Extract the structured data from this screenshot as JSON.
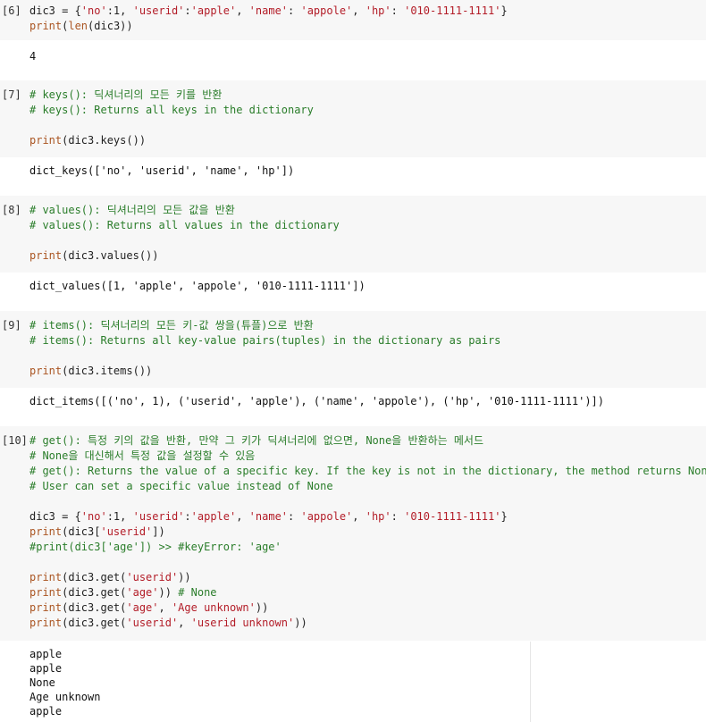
{
  "cells": [
    {
      "prompt": "[6]",
      "lines": [
        [
          {
            "t": "dic3 = {",
            "c": "n"
          },
          {
            "t": "'no'",
            "c": "s"
          },
          {
            "t": ":1, ",
            "c": "n"
          },
          {
            "t": "'userid'",
            "c": "s"
          },
          {
            "t": ":",
            "c": "n"
          },
          {
            "t": "'apple'",
            "c": "s"
          },
          {
            "t": ", ",
            "c": "n"
          },
          {
            "t": "'name'",
            "c": "s"
          },
          {
            "t": ": ",
            "c": "n"
          },
          {
            "t": "'appole'",
            "c": "s"
          },
          {
            "t": ", ",
            "c": "n"
          },
          {
            "t": "'hp'",
            "c": "s"
          },
          {
            "t": ": ",
            "c": "n"
          },
          {
            "t": "'010-1111-1111'",
            "c": "s"
          },
          {
            "t": "}",
            "c": "n"
          }
        ],
        [
          {
            "t": "print",
            "c": "f"
          },
          {
            "t": "(",
            "c": "n"
          },
          {
            "t": "len",
            "c": "f"
          },
          {
            "t": "(dic3))",
            "c": "n"
          }
        ]
      ],
      "output": [
        "4"
      ]
    },
    {
      "prompt": "[7]",
      "lines": [
        [
          {
            "t": "# keys(): 딕셔너리의 모든 키를 반환",
            "c": "k"
          }
        ],
        [
          {
            "t": "# keys(): Returns all keys in the dictionary",
            "c": "k"
          }
        ],
        [
          {
            "t": "",
            "c": "n"
          }
        ],
        [
          {
            "t": "print",
            "c": "f"
          },
          {
            "t": "(dic3.keys())",
            "c": "n"
          }
        ]
      ],
      "output": [
        "dict_keys(['no', 'userid', 'name', 'hp'])"
      ]
    },
    {
      "prompt": "[8]",
      "lines": [
        [
          {
            "t": "# values(): 딕셔너리의 모든 값을 반환",
            "c": "k"
          }
        ],
        [
          {
            "t": "# values(): Returns all values in the dictionary",
            "c": "k"
          }
        ],
        [
          {
            "t": "",
            "c": "n"
          }
        ],
        [
          {
            "t": "print",
            "c": "f"
          },
          {
            "t": "(dic3.values())",
            "c": "n"
          }
        ]
      ],
      "output": [
        "dict_values([1, 'apple', 'appole', '010-1111-1111'])"
      ]
    },
    {
      "prompt": "[9]",
      "lines": [
        [
          {
            "t": "# items(): 딕셔너리의 모든 키-값 쌍을(튜플)으로 반환",
            "c": "k"
          }
        ],
        [
          {
            "t": "# items(): Returns all key-value pairs(tuples) in the dictionary as pairs",
            "c": "k"
          }
        ],
        [
          {
            "t": "",
            "c": "n"
          }
        ],
        [
          {
            "t": "print",
            "c": "f"
          },
          {
            "t": "(dic3.items())",
            "c": "n"
          }
        ]
      ],
      "output": [
        "dict_items([('no', 1), ('userid', 'apple'), ('name', 'appole'), ('hp', '010-1111-1111')])"
      ]
    },
    {
      "prompt": "[10]",
      "lines": [
        [
          {
            "t": "# get(): 특정 키의 값을 반환, 만약 그 키가 딕셔너리에 없으면, None을 반환하는 메서드",
            "c": "k"
          }
        ],
        [
          {
            "t": "# None을 대신해서 특정 값을 설정할 수 있음",
            "c": "k"
          }
        ],
        [
          {
            "t": "# get(): Returns the value of a specific key. If the key is not in the dictionary, the method returns None.",
            "c": "k"
          }
        ],
        [
          {
            "t": "# User can set a specific value instead of None",
            "c": "k"
          }
        ],
        [
          {
            "t": "",
            "c": "n"
          }
        ],
        [
          {
            "t": "dic3 = {",
            "c": "n"
          },
          {
            "t": "'no'",
            "c": "s"
          },
          {
            "t": ":1, ",
            "c": "n"
          },
          {
            "t": "'userid'",
            "c": "s"
          },
          {
            "t": ":",
            "c": "n"
          },
          {
            "t": "'apple'",
            "c": "s"
          },
          {
            "t": ", ",
            "c": "n"
          },
          {
            "t": "'name'",
            "c": "s"
          },
          {
            "t": ": ",
            "c": "n"
          },
          {
            "t": "'appole'",
            "c": "s"
          },
          {
            "t": ", ",
            "c": "n"
          },
          {
            "t": "'hp'",
            "c": "s"
          },
          {
            "t": ": ",
            "c": "n"
          },
          {
            "t": "'010-1111-1111'",
            "c": "s"
          },
          {
            "t": "}",
            "c": "n"
          }
        ],
        [
          {
            "t": "print",
            "c": "f"
          },
          {
            "t": "(dic3[",
            "c": "n"
          },
          {
            "t": "'userid'",
            "c": "s"
          },
          {
            "t": "])",
            "c": "n"
          }
        ],
        [
          {
            "t": "#print(dic3['age']) >> #keyError: 'age'",
            "c": "k"
          }
        ],
        [
          {
            "t": "",
            "c": "n"
          }
        ],
        [
          {
            "t": "print",
            "c": "f"
          },
          {
            "t": "(dic3.get(",
            "c": "n"
          },
          {
            "t": "'userid'",
            "c": "s"
          },
          {
            "t": "))",
            "c": "n"
          }
        ],
        [
          {
            "t": "print",
            "c": "f"
          },
          {
            "t": "(dic3.get(",
            "c": "n"
          },
          {
            "t": "'age'",
            "c": "s"
          },
          {
            "t": ")) ",
            "c": "n"
          },
          {
            "t": "# None",
            "c": "k"
          }
        ],
        [
          {
            "t": "print",
            "c": "f"
          },
          {
            "t": "(dic3.get(",
            "c": "n"
          },
          {
            "t": "'age'",
            "c": "s"
          },
          {
            "t": ", ",
            "c": "n"
          },
          {
            "t": "'Age unknown'",
            "c": "s"
          },
          {
            "t": "))",
            "c": "n"
          }
        ],
        [
          {
            "t": "print",
            "c": "f"
          },
          {
            "t": "(dic3.get(",
            "c": "n"
          },
          {
            "t": "'userid'",
            "c": "s"
          },
          {
            "t": ", ",
            "c": "n"
          },
          {
            "t": "'userid unknown'",
            "c": "s"
          },
          {
            "t": "))",
            "c": "n"
          }
        ]
      ],
      "output": [
        "apple",
        "apple",
        "None",
        "Age unknown",
        "apple"
      ]
    }
  ],
  "colors": {
    "comment": "#2a7d2a",
    "builtin": "#aa5522",
    "string": "#b31d28",
    "input_bg": "#f7f7f7"
  }
}
